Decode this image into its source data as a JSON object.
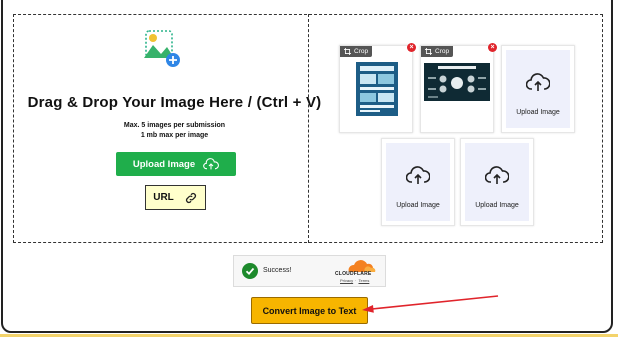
{
  "dropzone": {
    "title": "Drag & Drop Your Image Here / (Ctrl + V)",
    "limit_line1": "Max. 5 images per submission",
    "limit_line2": "1 mb max per image",
    "upload_button_label": "Upload Image",
    "url_button_label": "URL"
  },
  "thumbnails": [
    {
      "crop_label": "Crop",
      "remove_label": "×"
    },
    {
      "crop_label": "Crop",
      "remove_label": "×"
    }
  ],
  "upload_slots": [
    {
      "label": "Upload Image"
    },
    {
      "label": "Upload Image"
    },
    {
      "label": "Upload Image"
    }
  ],
  "captcha": {
    "status": "Success!",
    "provider": "CLOUDFLARE",
    "privacy_label": "Privacy",
    "separator": "·",
    "terms_label": "Terms"
  },
  "convert_button_label": "Convert Image to Text",
  "colors": {
    "upload_button": "#1fae4b",
    "url_button": "#ffffcc",
    "convert_button": "#f7b500",
    "remove_badge": "#e0242b",
    "success_check": "#1d8a2c",
    "annotation_arrow": "#e0242b"
  },
  "icons": {
    "upload_art": "image-plus-icon",
    "upload_button": "cloud-upload-icon",
    "url_button": "link-icon",
    "crop": "crop-icon",
    "remove": "close-icon",
    "slot": "cloud-upload-icon",
    "captcha": "check-icon",
    "provider": "cloudflare-logo-icon"
  }
}
